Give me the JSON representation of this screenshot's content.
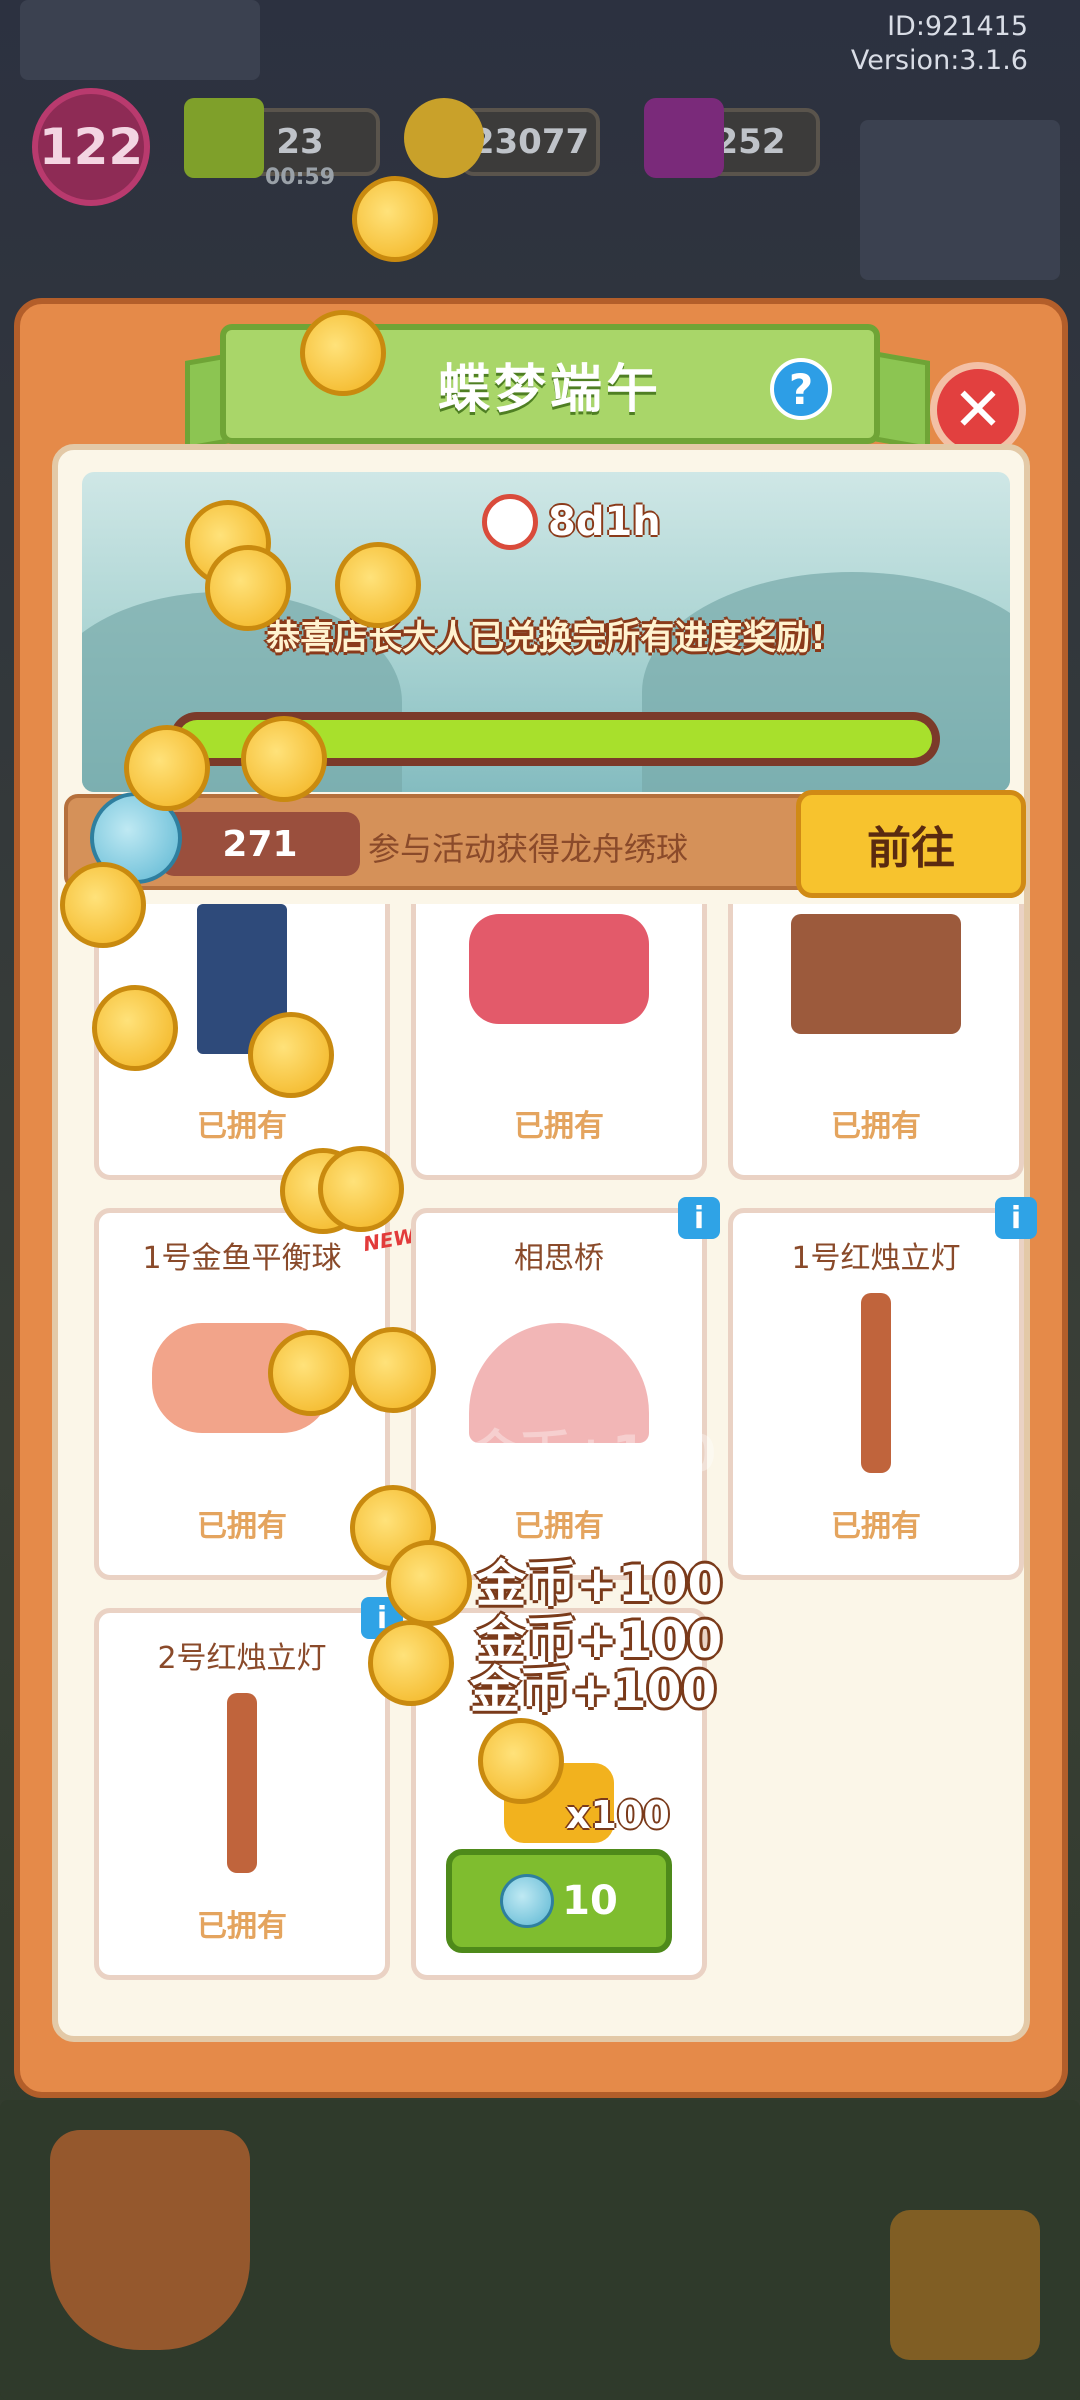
{
  "top_info": {
    "id_label": "ID:921415",
    "version_label": "Version:3.1.6"
  },
  "hud": {
    "level": "122",
    "energy": {
      "value": "23",
      "timer": "00:59"
    },
    "coins": {
      "value": "23077"
    },
    "gems": {
      "value": "252"
    }
  },
  "event": {
    "title": "蝶梦端午",
    "timer": "8d1h",
    "congrats": "恭喜店长大人已兑换完所有进度奖励!",
    "progress_fraction": 1.0
  },
  "currency_bar": {
    "count": "271",
    "hint": "参与活动获得龙舟绣球",
    "go_label": "前往"
  },
  "items": [
    {
      "title": "",
      "status": "已拥有"
    },
    {
      "title": "",
      "status": "已拥有"
    },
    {
      "title": "",
      "status": "已拥有"
    },
    {
      "title": "1号金鱼平衡球",
      "status": "已拥有"
    },
    {
      "title": "相思桥",
      "status": "已拥有"
    },
    {
      "title": "1号红烛立灯",
      "status": "已拥有"
    },
    {
      "title": "2号红烛立灯",
      "status": "已拥有"
    }
  ],
  "new_badge": "NEW!",
  "coin_pack": {
    "amount": "x100",
    "price": "10"
  },
  "float_texts": [
    "金币+100",
    "金币+100",
    "金币+100",
    "金币+100"
  ],
  "colors": {
    "panel": "#e58a49",
    "ribbon": "#a9d669",
    "go": "#f7c32e",
    "buy": "#7fbd2f"
  }
}
